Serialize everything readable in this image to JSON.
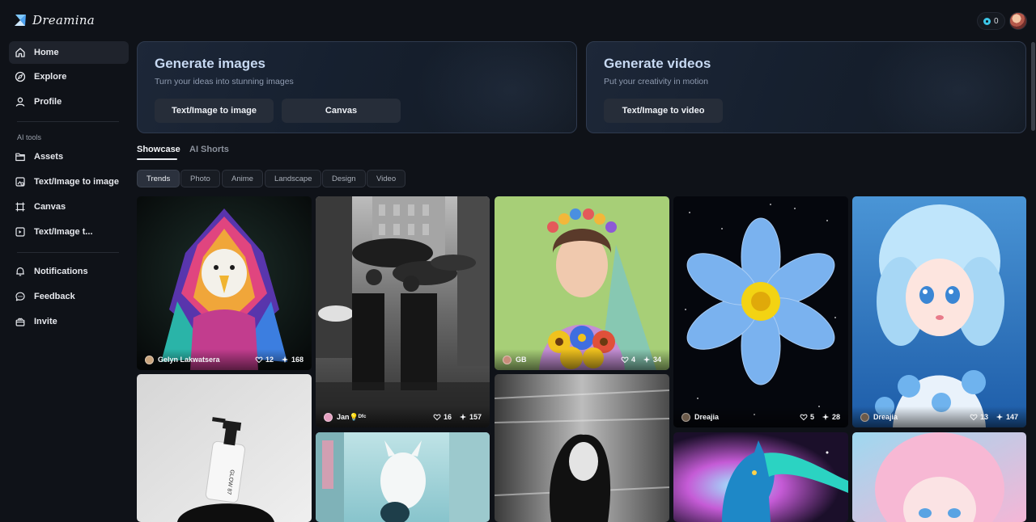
{
  "app": {
    "name": "Dreamina"
  },
  "sidebar": {
    "primary": [
      {
        "label": "Home",
        "icon": "home-icon"
      },
      {
        "label": "Explore",
        "icon": "compass-icon"
      },
      {
        "label": "Profile",
        "icon": "user-icon"
      }
    ],
    "section_title": "AI tools",
    "tools": [
      {
        "label": "Assets",
        "icon": "folder-icon"
      },
      {
        "label": "Text/Image to image",
        "icon": "image-edit-icon"
      },
      {
        "label": "Canvas",
        "icon": "canvas-icon"
      },
      {
        "label": "Text/Image t...",
        "icon": "video-edit-icon"
      }
    ],
    "secondary": [
      {
        "label": "Notifications",
        "icon": "bell-icon"
      },
      {
        "label": "Feedback",
        "icon": "chat-icon"
      },
      {
        "label": "Invite",
        "icon": "gift-icon"
      }
    ]
  },
  "header": {
    "credits": "0"
  },
  "hero": {
    "images": {
      "title": "Generate images",
      "subtitle": "Turn your ideas into stunning images",
      "buttons": [
        "Text/Image to image",
        "Canvas"
      ]
    },
    "videos": {
      "title": "Generate videos",
      "subtitle": "Put your creativity in motion",
      "buttons": [
        "Text/Image to video"
      ]
    }
  },
  "tabs": [
    "Showcase",
    "AI Shorts"
  ],
  "filters": [
    "Trends",
    "Photo",
    "Anime",
    "Landscape",
    "Design",
    "Video"
  ],
  "gallery": [
    {
      "author": "Gelyn Lakwatsera",
      "likes": "12",
      "uses": "168"
    },
    {
      "author": "Jan💡ᴰᶠᶜ",
      "likes": "16",
      "uses": "157"
    },
    {
      "author": "GB",
      "likes": "4",
      "uses": "34"
    },
    {
      "author": "Dreajia",
      "likes": "5",
      "uses": "28"
    },
    {
      "author": "Dreajia",
      "likes": "13",
      "uses": "147"
    }
  ],
  "product_label": "GLOW 87"
}
